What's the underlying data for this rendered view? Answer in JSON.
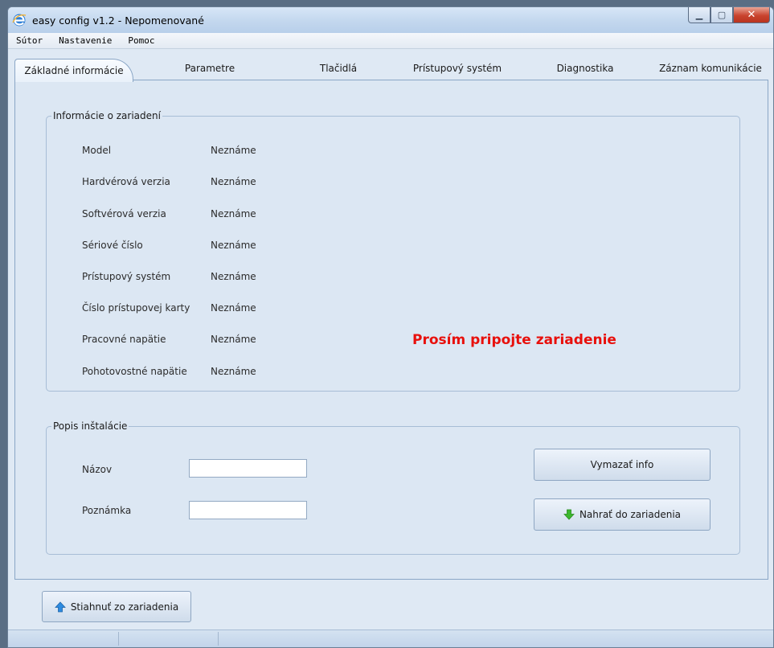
{
  "window": {
    "title": "easy config v1.2 - Nepomenované",
    "buttons": {
      "minimize": "▁",
      "maximize": "▢",
      "close": "✕"
    }
  },
  "menu": [
    "Sútor",
    "Nastavenie",
    "Pomoc"
  ],
  "tabs": [
    {
      "label": "Základné informácie",
      "active": true
    },
    {
      "label": "Parametre",
      "active": false
    },
    {
      "label": "Tlačidlá",
      "active": false
    },
    {
      "label": "Prístupový systém",
      "active": false
    },
    {
      "label": "Diagnostika",
      "active": false
    },
    {
      "label": "Záznam komunikácie",
      "active": false
    }
  ],
  "device_info": {
    "title": "Informácie o zariadení",
    "rows": [
      {
        "label": "Model",
        "value": "Neznáme"
      },
      {
        "label": "Hardvérová verzia",
        "value": "Neznáme"
      },
      {
        "label": "Softvérová verzia",
        "value": "Neznáme"
      },
      {
        "label": "Sériové číslo",
        "value": "Neznáme"
      },
      {
        "label": "Prístupový systém",
        "value": "Neznáme"
      },
      {
        "label": "Číslo prístupovej karty",
        "value": "Neznáme"
      },
      {
        "label": "Pracovné napätie",
        "value": "Neznáme"
      },
      {
        "label": "Pohotovostné napätie",
        "value": "Neznáme"
      }
    ],
    "warning": "Prosím pripojte zariadenie"
  },
  "install": {
    "title": "Popis inštalácie",
    "name_label": "Názov",
    "name_value": "",
    "note_label": "Poznámka",
    "note_value": "",
    "clear_button": "Vymazať info",
    "upload_button": "Nahrať do zariadenia"
  },
  "footer": {
    "download_button": "Stiahnuť zo zariadenia"
  },
  "colors": {
    "warning": "#e8100c",
    "upload_arrow": "#3cb82e",
    "download_arrow": "#2d8be0"
  },
  "icons": {
    "app": "ie-e-icon",
    "upload": "arrow-down-green-icon",
    "download": "arrow-up-blue-icon"
  }
}
